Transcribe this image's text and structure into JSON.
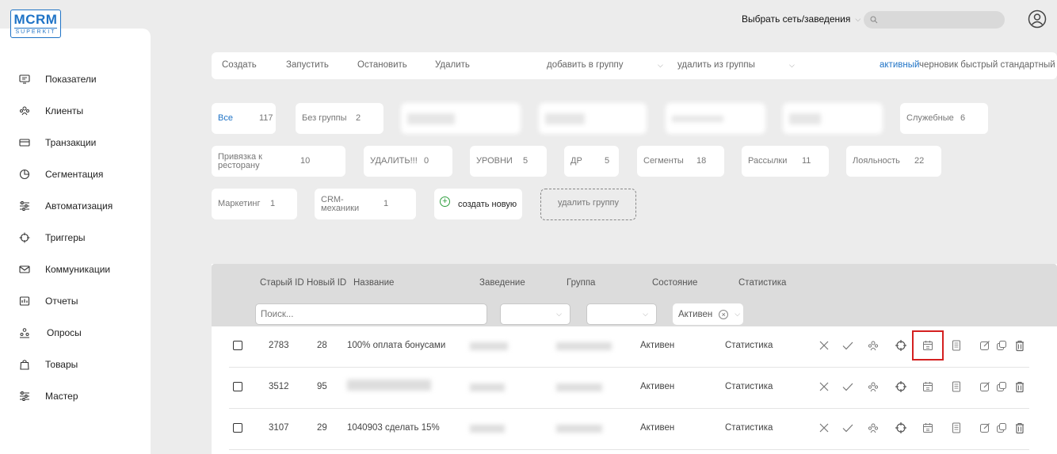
{
  "logo": {
    "title": "MCRM",
    "subtitle": "SUPERKIT"
  },
  "header": {
    "network_select": "Выбрать сеть/заведения",
    "search_placeholder": ""
  },
  "sidebar": {
    "items": [
      {
        "label": "Показатели",
        "icon": "monitor-icon"
      },
      {
        "label": "Клиенты",
        "icon": "users-icon"
      },
      {
        "label": "Транзакции",
        "icon": "card-icon"
      },
      {
        "label": "Сегментация",
        "icon": "pie-icon"
      },
      {
        "label": "Автоматизация",
        "icon": "sliders-icon"
      },
      {
        "label": "Триггеры",
        "icon": "crosshair-icon"
      },
      {
        "label": "Коммуникации",
        "icon": "mail-icon"
      },
      {
        "label": "Отчеты",
        "icon": "report-icon"
      },
      {
        "label": "Опросы",
        "icon": "survey-icon"
      },
      {
        "label": "Товары",
        "icon": "bag-icon"
      },
      {
        "label": "Мастер",
        "icon": "sliders-icon"
      }
    ]
  },
  "toolbar": {
    "create": "Создать",
    "start": "Запустить",
    "stop": "Остановить",
    "delete": "Удалить",
    "add_to_group": "добавить в группу",
    "remove_from_group": "удалить из группы",
    "status_active": "активный",
    "status_others": "черновик быстрый стандартный"
  },
  "groups": [
    {
      "name": "Все",
      "count": "117"
    },
    {
      "name": "Без группы",
      "count": "2"
    },
    {
      "name": "",
      "count": ""
    },
    {
      "name": "",
      "count": ""
    },
    {
      "name": "",
      "count": ""
    },
    {
      "name": "",
      "count": ""
    },
    {
      "name": "Служебные",
      "count": "6"
    },
    {
      "name": "Привязка к ресторану",
      "count": "10"
    },
    {
      "name": "УДАЛИТЬ!!!",
      "count": "0"
    },
    {
      "name": "УРОВНИ",
      "count": "5"
    },
    {
      "name": "ДР",
      "count": "5"
    },
    {
      "name": "Сегменты",
      "count": "18"
    },
    {
      "name": "Рассылки",
      "count": "11"
    },
    {
      "name": "Лояльность",
      "count": "22"
    },
    {
      "name": "Маркетинг",
      "count": "1"
    },
    {
      "name": "CRM-механики",
      "count": "1"
    }
  ],
  "create_group": "создать новую",
  "delete_group": "удалить группу",
  "table": {
    "columns": {
      "old_id": "Старый ID",
      "new_id": "Новый ID",
      "name": "Название",
      "venue": "Заведение",
      "group": "Группа",
      "state": "Состояние",
      "stats": "Статистика"
    },
    "search_placeholder": "Поиск...",
    "state_filter": "Активен",
    "rows": [
      {
        "old_id": "2783",
        "new_id": "28",
        "name": "100% оплата бонусами",
        "state": "Активен",
        "stats": "Статистика"
      },
      {
        "old_id": "3512",
        "new_id": "95",
        "name": "",
        "state": "Активен",
        "stats": "Статистика"
      },
      {
        "old_id": "3107",
        "new_id": "29",
        "name": "1040903 сделать 15%",
        "state": "Активен",
        "stats": "Статистика"
      }
    ]
  },
  "colors": {
    "accent": "#1f73c6",
    "highlight": "#d42020",
    "create_green": "#2e9e3e"
  }
}
